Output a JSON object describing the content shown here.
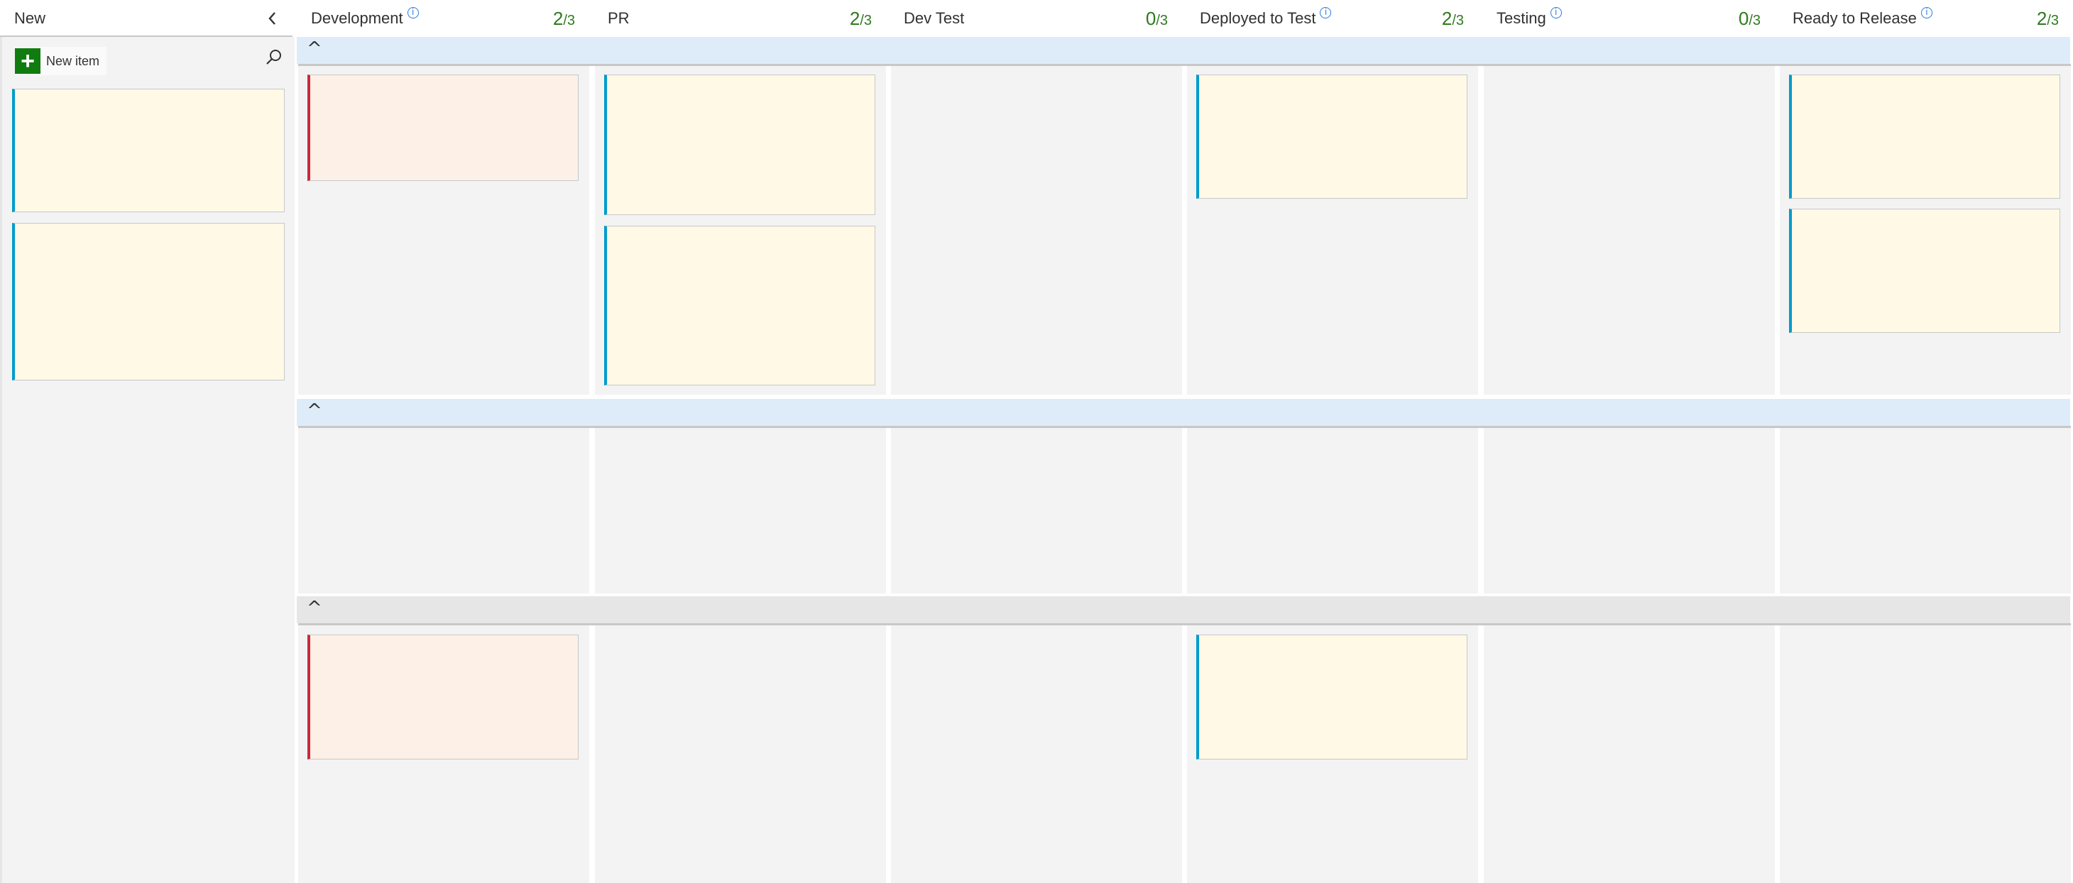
{
  "board": {
    "columns": [
      {
        "id": "new",
        "title": "New",
        "has_info": false,
        "count": "",
        "limit": ""
      },
      {
        "id": "development",
        "title": "Development",
        "has_info": true,
        "count": "2",
        "limit": "/3"
      },
      {
        "id": "pr",
        "title": "PR",
        "has_info": false,
        "count": "2",
        "limit": "/3"
      },
      {
        "id": "dev-test",
        "title": "Dev Test",
        "has_info": false,
        "count": "0",
        "limit": "/3"
      },
      {
        "id": "deployed-to-test",
        "title": "Deployed to Test",
        "has_info": true,
        "count": "2",
        "limit": "/3"
      },
      {
        "id": "testing",
        "title": "Testing",
        "has_info": true,
        "count": "0",
        "limit": "/3"
      },
      {
        "id": "ready-to-release",
        "title": "Ready to Release",
        "has_info": true,
        "count": "2",
        "limit": "/3"
      }
    ],
    "new_column": {
      "new_item_label": "New item",
      "collapse_icon": "chevron-left-icon",
      "search_icon": "search-icon"
    },
    "swimlanes": [
      {
        "expanded": true,
        "chevron": "^"
      },
      {
        "expanded": true,
        "chevron": "^"
      },
      {
        "expanded": true,
        "chevron": "^"
      }
    ],
    "colors": {
      "task_bar": "#009ccc",
      "bug_bar": "#cc293d",
      "card_bg": "#fff9e6",
      "bug_bg": "#fdf0e6",
      "count": "#2f7a1f",
      "add_button": "#107c10"
    },
    "info_icon": "i"
  }
}
